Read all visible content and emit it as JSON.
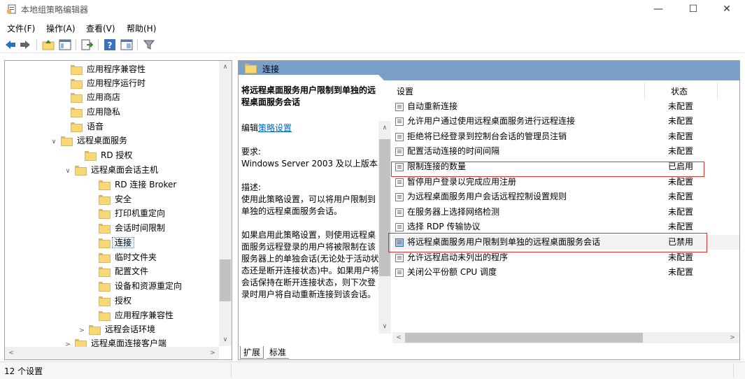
{
  "window": {
    "title": "本地组策略编辑器",
    "minimize": "—",
    "maximize": "☐",
    "close": "✕"
  },
  "menu": [
    "文件(F)",
    "操作(A)",
    "查看(V)",
    "帮助(H)"
  ],
  "toolbar": {
    "icons": [
      "back-arrow-icon",
      "forward-arrow-icon",
      "up-folder-icon",
      "show-hide-tree-icon",
      "export-list-icon",
      "help-icon",
      "extended-view-icon",
      "filter-icon"
    ]
  },
  "tree": {
    "items": [
      {
        "label": "应用程序兼容性",
        "chevron": ""
      },
      {
        "label": "应用程序运行时",
        "chevron": ""
      },
      {
        "label": "应用商店",
        "chevron": ""
      },
      {
        "label": "应用隐私",
        "chevron": ""
      },
      {
        "label": "语音",
        "chevron": ""
      },
      {
        "label": "远程桌面服务",
        "chevron": "∨"
      },
      {
        "label": "RD 授权",
        "chevron": ""
      },
      {
        "label": "远程桌面会话主机",
        "chevron": "∨"
      },
      {
        "label": "RD 连接 Broker",
        "chevron": ""
      },
      {
        "label": "安全",
        "chevron": ""
      },
      {
        "label": "打印机重定向",
        "chevron": ""
      },
      {
        "label": "会话时间限制",
        "chevron": ""
      },
      {
        "label": "连接",
        "chevron": ""
      },
      {
        "label": "临时文件夹",
        "chevron": ""
      },
      {
        "label": "配置文件",
        "chevron": ""
      },
      {
        "label": "设备和资源重定向",
        "chevron": ""
      },
      {
        "label": "授权",
        "chevron": ""
      },
      {
        "label": "应用程序兼容性",
        "chevron": ""
      },
      {
        "label": "远程会话环境",
        "chevron": ">"
      },
      {
        "label": "远程桌面连接客户端",
        "chevron": ">"
      }
    ]
  },
  "right": {
    "header": "连接",
    "description": {
      "title": "将远程桌面服务用户限制到单独的远程桌面服务会话",
      "edit_prefix": "编辑",
      "edit_link": "策略设置",
      "requirements_label": "要求:",
      "requirements": "Windows Server 2003 及以上版本",
      "desc_label": "描述:",
      "desc": "使用此策略设置，可以将用户限制到单独的远程桌面服务会话。",
      "detail": "如果启用此策略设置，则使用远程桌面服务远程登录的用户将被限制在该服务器上的单独会话(无论处于活动状态还是断开连接状态)中。如果用户将会话保持在断开连接状态，则下次登录时用户将自动重新连接到该会话。"
    },
    "columns": {
      "setting": "设置",
      "state": "状态"
    },
    "rows": [
      {
        "name": "自动重新连接",
        "state": "未配置"
      },
      {
        "name": "允许用户通过使用远程桌面服务进行远程连接",
        "state": "未配置"
      },
      {
        "name": "拒绝将已经登录到控制台会话的管理员注销",
        "state": "未配置"
      },
      {
        "name": "配置活动连接的时间间隔",
        "state": "未配置"
      },
      {
        "name": "限制连接的数量",
        "state": "已启用"
      },
      {
        "name": "暂停用户登录以完成应用注册",
        "state": "未配置"
      },
      {
        "name": "为远程桌面服务用户会话远程控制设置规则",
        "state": "未配置"
      },
      {
        "name": "在服务器上选择网络检测",
        "state": "未配置"
      },
      {
        "name": "选择 RDP 传输协议",
        "state": "未配置"
      },
      {
        "name": "将远程桌面服务用户限制到单独的远程桌面服务会话",
        "state": "已禁用"
      },
      {
        "name": "允许远程启动未列出的程序",
        "state": "未配置"
      },
      {
        "name": "关闭公平份额 CPU 调度",
        "state": "未配置"
      }
    ],
    "tabs": [
      "扩展",
      "标准"
    ]
  },
  "status": {
    "text": "12 个设置"
  },
  "colors": {
    "header_blue": "#7a9fc8",
    "highlight_red": "#e03030",
    "link": "#0066cc"
  }
}
